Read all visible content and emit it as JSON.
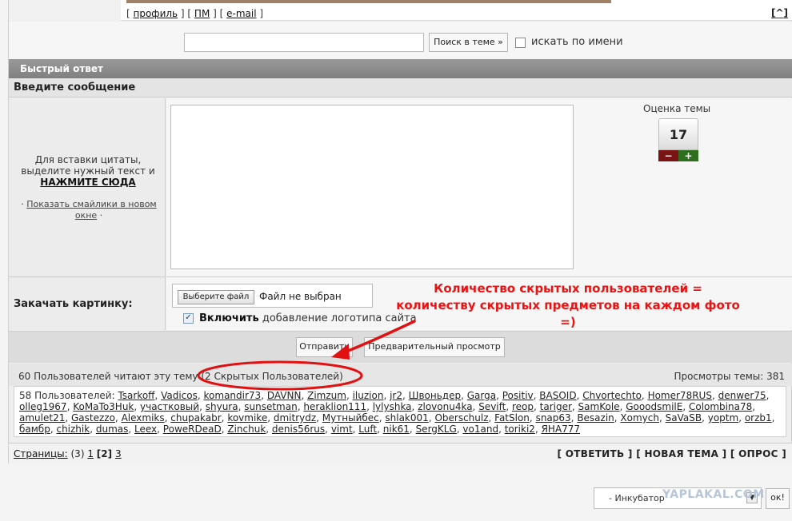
{
  "top": {
    "links": [
      {
        "label": "профиль"
      },
      {
        "label": "ПМ"
      },
      {
        "label": "e-mail"
      }
    ],
    "up_label": "[^]"
  },
  "search": {
    "button_label": "Поиск в теме »",
    "checkbox_label": "искать по имени"
  },
  "quick_reply": {
    "header": "Быстрый ответ",
    "enter_message": "Введите сообщение",
    "quote_hint": "Для вставки цитаты, выделите нужный текст и",
    "quote_link": "НАЖМИТЕ СЮДА",
    "smiles_link": "Показать смайлики в новом окне"
  },
  "rating": {
    "label": "Оценка темы",
    "value": "17",
    "minus": "−",
    "plus": "+"
  },
  "upload": {
    "label": "Закачать картинку:",
    "file_button": "Выберите файл",
    "file_status": "Файл не выбран",
    "logo_bold": "Включить",
    "logo_rest": "добавление логотипа сайта"
  },
  "submit": {
    "send_label": "Отправить",
    "preview_label": "Предварительный просмотр"
  },
  "readers": {
    "count_text": "60 Пользователей читают эту тему",
    "hidden_text": "(2 Скрытых Пользователей)",
    "views_text": "Просмотры темы: 381",
    "users_prefix": "58 Пользователей:",
    "users": [
      "Tsarkoff",
      "Vadicos",
      "komandir73",
      "DAVNN",
      "Zimzum",
      "iluzion",
      "jr2",
      "Швоньдер",
      "Garga",
      "Positiv",
      "BASOID",
      "Chvortechto",
      "Homer78RUS",
      "denwer75",
      "olleg1967",
      "KoMaTo3Huk",
      "участковый",
      "shyura",
      "sunsetman",
      "heraklion111",
      "lylyshka",
      "zlovonu4ka",
      "Sevift",
      "reop",
      "tariger",
      "SamKole",
      "GooodsmilE",
      "Colombina78",
      "amulet21",
      "Gastezzo",
      "Alexmiks",
      "chupakabr",
      "kovmike",
      "dmitrydz",
      "Мутныйбес",
      "shlak001",
      "Oberschulz",
      "FatSlon",
      "snap63",
      "Besazin",
      "Xomych",
      "SaVaSB",
      "yoptm",
      "orzb1",
      "бамбр",
      "chizhik",
      "dumas",
      "Leex",
      "PoweRDeaD",
      "Zinchuk",
      "denis56rus",
      "vimt",
      "Luft",
      "nik61",
      "SergKLG",
      "vo1and",
      "toriki2",
      "ЯНА777"
    ]
  },
  "pages": {
    "label": "Страницы:",
    "count": "(3)",
    "p1": "1",
    "current": "[2]",
    "p3": "3"
  },
  "actions": {
    "reply": "[ ОТВЕТИТЬ ]",
    "new_topic": "[ НОВАЯ ТЕМА ]",
    "poll": "[ ОПРОС ]"
  },
  "jump": {
    "selected": "- Инкубатор",
    "ok": "ок!",
    "watermark": "YAPLAKAL.COM"
  },
  "annotation": {
    "line1": "Количество скрытых пользователей =",
    "line2": "количеству скрытых предметов на каждом фото =)",
    "color": "#e11111"
  }
}
